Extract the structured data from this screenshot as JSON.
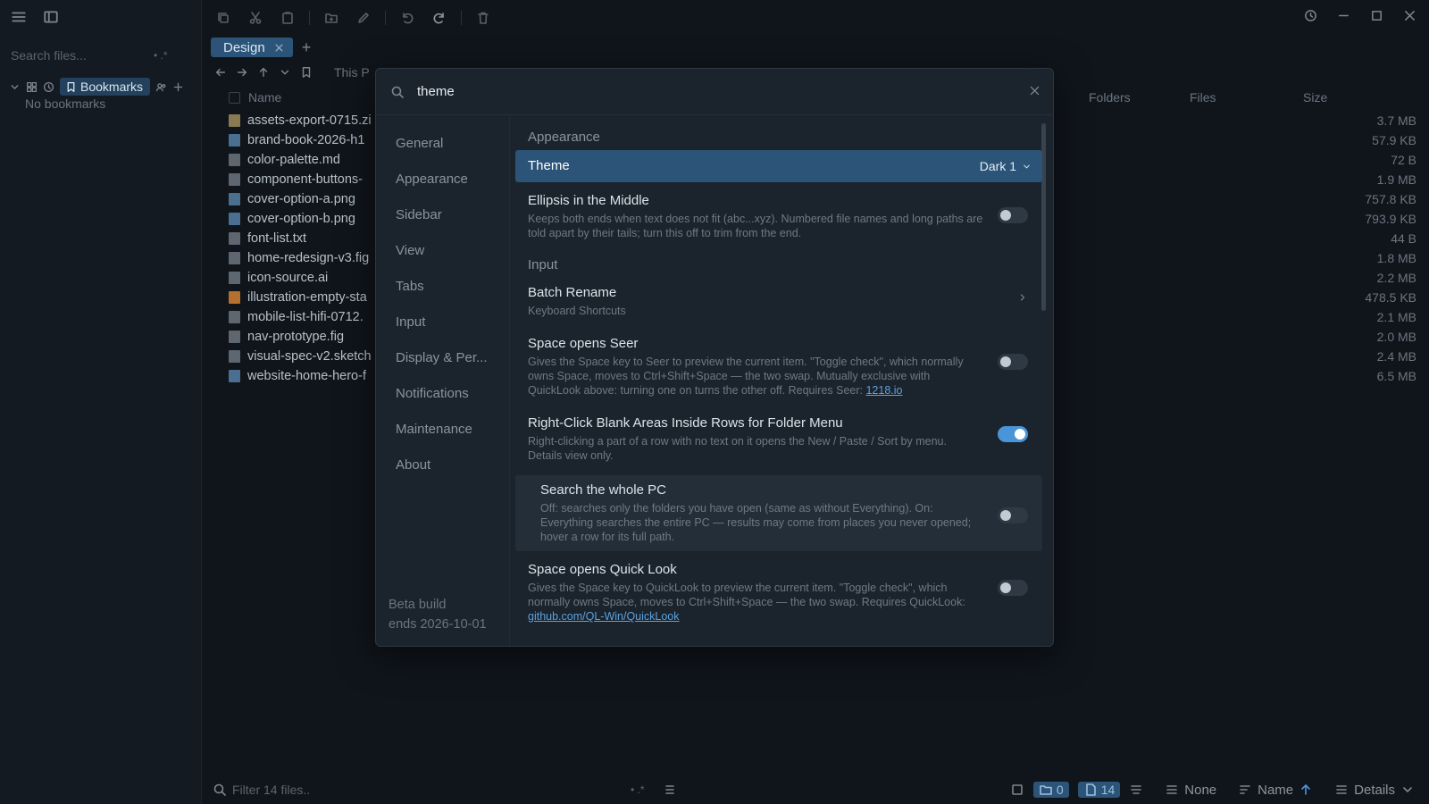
{
  "sidebar": {
    "search_placeholder": "Search files...",
    "search_opts": "•  .*",
    "bookmarks_label": "Bookmarks",
    "empty_text": "No bookmarks"
  },
  "tabs": [
    {
      "label": "Design"
    }
  ],
  "nav": {
    "breadcrumb": "This P"
  },
  "columns": {
    "name": "Name",
    "folders": "Folders",
    "files": "Files",
    "size": "Size"
  },
  "files": [
    {
      "name": "assets-export-0715.zi",
      "size": "3.7 MB",
      "icon": "zip"
    },
    {
      "name": "brand-book-2026-h1",
      "size": "57.9 KB",
      "icon": "img"
    },
    {
      "name": "color-palette.md",
      "size": "72 B",
      "icon": "doc"
    },
    {
      "name": "component-buttons-",
      "size": "1.9 MB",
      "icon": "doc"
    },
    {
      "name": "cover-option-a.png",
      "size": "757.8 KB",
      "icon": "img"
    },
    {
      "name": "cover-option-b.png",
      "size": "793.9 KB",
      "icon": "img"
    },
    {
      "name": "font-list.txt",
      "size": "44 B",
      "icon": "doc"
    },
    {
      "name": "home-redesign-v3.fig",
      "size": "1.8 MB",
      "icon": "doc"
    },
    {
      "name": "icon-source.ai",
      "size": "2.2 MB",
      "icon": "doc"
    },
    {
      "name": "illustration-empty-sta",
      "size": "478.5 KB",
      "icon": "ai"
    },
    {
      "name": "mobile-list-hifi-0712.",
      "size": "2.1 MB",
      "icon": "doc"
    },
    {
      "name": "nav-prototype.fig",
      "size": "2.0 MB",
      "icon": "doc"
    },
    {
      "name": "visual-spec-v2.sketch",
      "size": "2.4 MB",
      "icon": "doc"
    },
    {
      "name": "website-home-hero-f",
      "size": "6.5 MB",
      "icon": "img"
    }
  ],
  "statusbar": {
    "filter_placeholder": "Filter 14 files..",
    "filter_opts": "•  .*",
    "folder_count": "0",
    "file_count": "14",
    "group_label": "None",
    "sort_label": "Name",
    "view_label": "Details"
  },
  "modal": {
    "search_value": "theme",
    "nav_items": [
      "General",
      "Appearance",
      "Sidebar",
      "View",
      "Tabs",
      "Input",
      "Display & Per...",
      "Notifications",
      "Maintenance",
      "About"
    ],
    "beta_line1": "Beta build",
    "beta_line2": "ends 2026-10-01",
    "sections": {
      "appearance": "Appearance",
      "input": "Input"
    },
    "settings": {
      "theme": {
        "title": "Theme",
        "value": "Dark 1"
      },
      "ellipsis": {
        "title": "Ellipsis in the Middle",
        "desc": "Keeps both ends when text does not fit (abc...xyz). Numbered file names and long paths are told apart by their tails; turn this off to trim from the end.",
        "on": false
      },
      "batch_rename": {
        "title": "Batch Rename",
        "desc": "Keyboard Shortcuts"
      },
      "space_seer": {
        "title": "Space opens Seer",
        "desc": "Gives the Space key to Seer to preview the current item. \"Toggle check\", which normally owns Space, moves to Ctrl+Shift+Space — the two swap. Mutually exclusive with QuickLook above: turning one on turns the other off. Requires Seer:",
        "link": "1218.io",
        "on": false
      },
      "right_click": {
        "title": "Right-Click Blank Areas Inside Rows for Folder Menu",
        "desc": "Right-clicking a part of a row with no text on it opens the New / Paste / Sort by menu. Details view only.",
        "on": true
      },
      "search_pc": {
        "title": "Search the whole PC",
        "desc": "Off: searches only the folders you have open (same as without Everything). On: Everything searches the entire PC — results may come from places you never opened; hover a row for its full path.",
        "on": false
      },
      "quicklook": {
        "title": "Space opens Quick Look",
        "desc": "Gives the Space key to QuickLook to preview the current item. \"Toggle check\", which normally owns Space, moves to Ctrl+Shift+Space — the two swap. Requires QuickLook:",
        "link": "github.com/QL-Win/QuickLook",
        "on": false
      }
    }
  },
  "colors": {
    "background": "#10151b",
    "modal_bg": "#1b232c",
    "accent": "#2b5478",
    "toggle_on": "#4a95d8"
  }
}
